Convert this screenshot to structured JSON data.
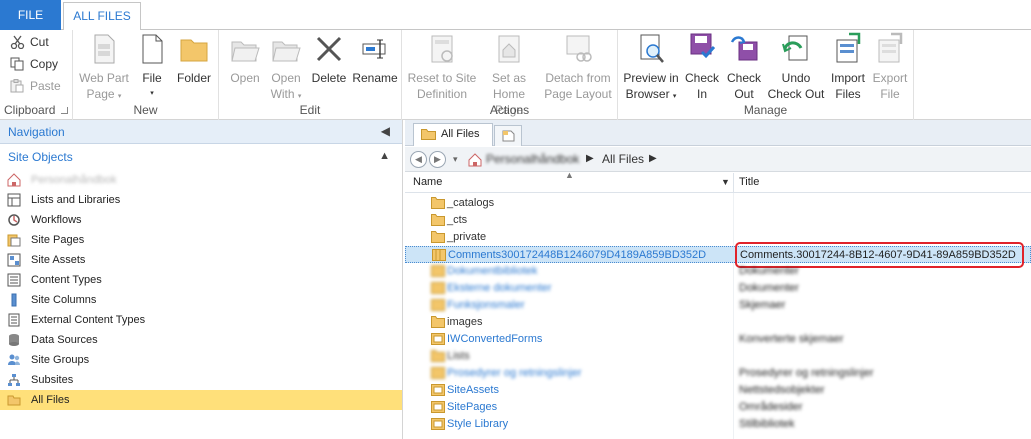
{
  "tabs": {
    "file": "FILE",
    "all_files": "ALL FILES"
  },
  "ribbon": {
    "clipboard": {
      "label": "Clipboard",
      "cut": "Cut",
      "copy": "Copy",
      "paste": "Paste"
    },
    "new": {
      "label": "New",
      "web_part_page_1": "Web Part",
      "web_part_page_2": "Page",
      "file_1": "File",
      "folder": "Folder"
    },
    "edit": {
      "label": "Edit",
      "open": "Open",
      "open_with_1": "Open",
      "open_with_2": "With",
      "delete": "Delete",
      "rename": "Rename"
    },
    "actions": {
      "label": "Actions",
      "reset_1": "Reset to Site",
      "reset_2": "Definition",
      "home_1": "Set as",
      "home_2": "Home Page",
      "detach_1": "Detach from",
      "detach_2": "Page Layout"
    },
    "manage": {
      "label": "Manage",
      "preview_1": "Preview in",
      "preview_2": "Browser",
      "checkin_1": "Check",
      "checkin_2": "In",
      "checkout_1": "Check",
      "checkout_2": "Out",
      "undo_1": "Undo",
      "undo_2": "Check Out",
      "import_1": "Import",
      "import_2": "Files",
      "export_1": "Export",
      "export_2": "File"
    }
  },
  "navigation": {
    "header": "Navigation",
    "section": "Site Objects",
    "items": [
      {
        "label": "Personalhåndbok",
        "blurred": true
      },
      {
        "label": "Lists and Libraries"
      },
      {
        "label": "Workflows"
      },
      {
        "label": "Site Pages"
      },
      {
        "label": "Site Assets"
      },
      {
        "label": "Content Types"
      },
      {
        "label": "Site Columns"
      },
      {
        "label": "External Content Types"
      },
      {
        "label": "Data Sources"
      },
      {
        "label": "Site Groups"
      },
      {
        "label": "Subsites"
      },
      {
        "label": "All Files",
        "selected": true
      }
    ]
  },
  "main": {
    "tab": "All Files",
    "breadcrumb_site": "Personalhåndbok",
    "breadcrumb_current": "All Files",
    "columns": {
      "name": "Name",
      "title": "Title"
    },
    "rows": [
      {
        "name": "_catalogs",
        "title": ""
      },
      {
        "name": "_cts",
        "title": ""
      },
      {
        "name": "_private",
        "title": ""
      },
      {
        "name": "Comments300172448B1246079D4189A859BD352D",
        "title": "Comments.30017244-8B12-4607-9D41-89A859BD352D"
      },
      {
        "name": "Dokumentbibliotek",
        "title": "Dokumenter"
      },
      {
        "name": "Eksterne dokumenter",
        "title": "Dokumenter"
      },
      {
        "name": "Funksjonsmaler",
        "title": "Skjemaer"
      },
      {
        "name": "images",
        "title": ""
      },
      {
        "name": "IWConvertedForms",
        "title": "Konverterte skjemaer"
      },
      {
        "name": "Lists",
        "title": ""
      },
      {
        "name": "Prosedyrer og retningslinjer",
        "title": "Prosedyrer og retningslinjer"
      },
      {
        "name": "SiteAssets",
        "title": "Nettstedsobjekter"
      },
      {
        "name": "SitePages",
        "title": "Områdesider"
      },
      {
        "name": "Style Library",
        "title": "Stilbibliotek"
      }
    ]
  }
}
